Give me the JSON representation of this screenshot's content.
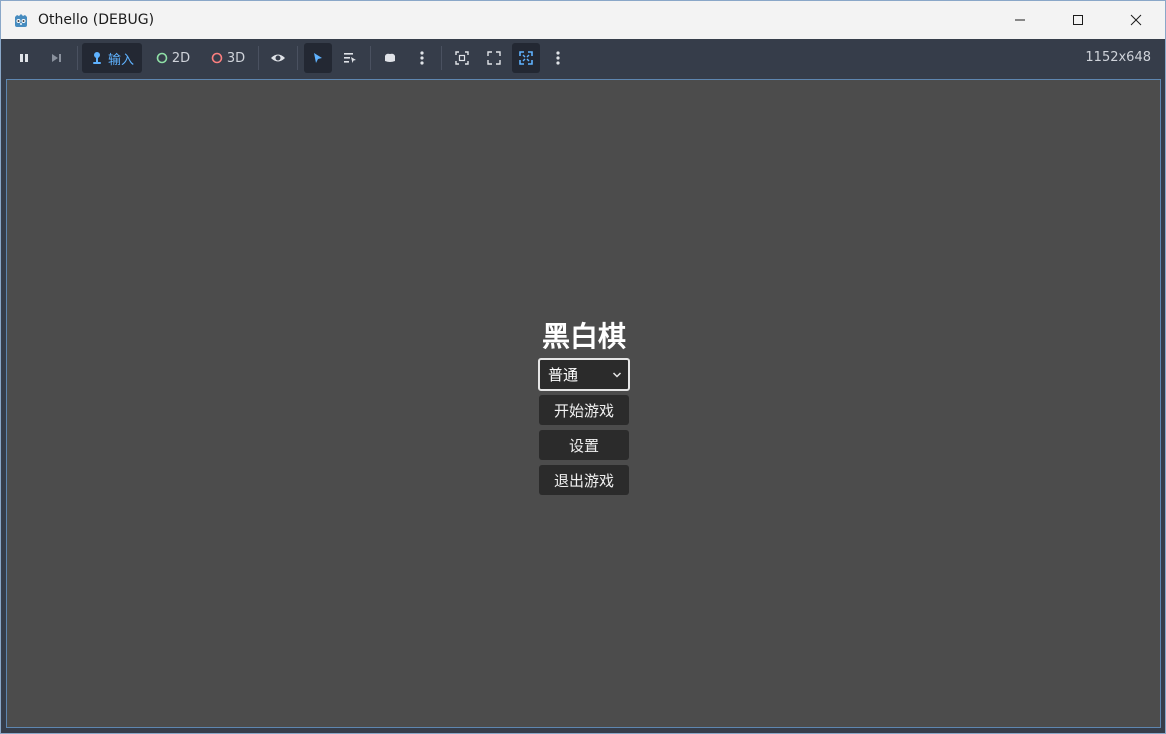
{
  "window": {
    "title": "Othello (DEBUG)"
  },
  "toolbar": {
    "input_label": "输入",
    "mode_2d_label": "2D",
    "mode_3d_label": "3D",
    "resolution": "1152x648",
    "colors": {
      "accent": "#5fb2ff",
      "dot_2d": "#8fe0a6",
      "dot_3d": "#fc7f7f"
    }
  },
  "menu": {
    "title": "黑白棋",
    "difficulty_selected": "普通",
    "start_button": "开始游戏",
    "settings_button": "设置",
    "quit_button": "退出游戏"
  }
}
